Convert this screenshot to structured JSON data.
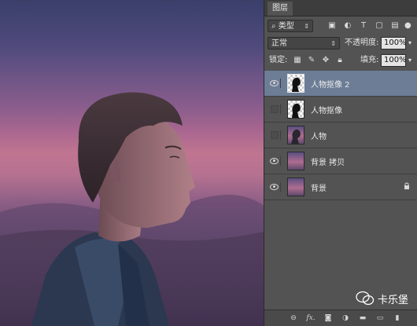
{
  "panel": {
    "tab_label": "图层",
    "filter": {
      "label": "类型"
    },
    "blend_mode": "正常",
    "opacity_label": "不透明度:",
    "opacity_value": "100%",
    "lock_label": "锁定:",
    "fill_label": "填充:",
    "fill_value": "100%"
  },
  "layers": [
    {
      "name": "人物抠像 2",
      "visible": true,
      "selected": true
    },
    {
      "name": "人物抠像",
      "visible": false,
      "selected": false
    },
    {
      "name": "人物",
      "visible": false,
      "selected": false
    },
    {
      "name": "背景 拷贝",
      "visible": true,
      "selected": false
    },
    {
      "name": "背景",
      "visible": true,
      "selected": false,
      "locked": true
    }
  ],
  "bottom_icons": [
    "link-icon",
    "fx-icon",
    "mask-icon",
    "adjustment-icon",
    "group-icon",
    "new-layer-icon",
    "trash-icon"
  ],
  "bottom_fx": "fx.",
  "watermark": "卡乐堡",
  "colors": {
    "selected_layer": "#6d7d96",
    "panel_bg": "#535353"
  }
}
